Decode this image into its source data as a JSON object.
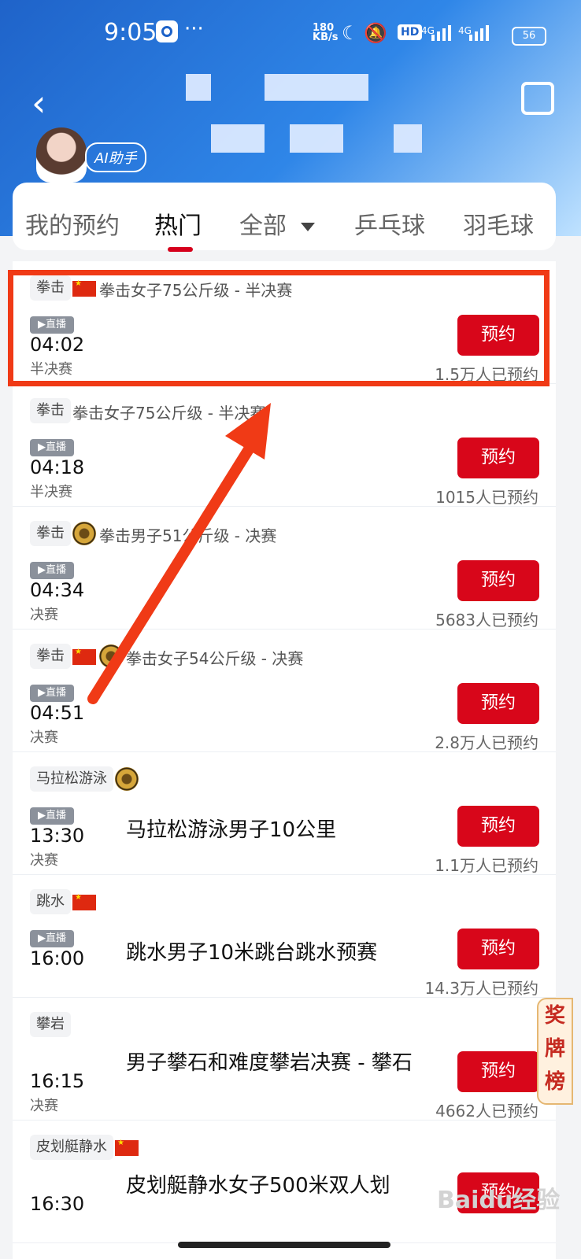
{
  "status_bar": {
    "time": "9:05",
    "more": "···",
    "speed_top": "180",
    "speed_bottom": "KB/s",
    "hd": "HD",
    "network_1": "4G",
    "network_2": "4G",
    "battery": "56",
    "icons": [
      "app-icon",
      "moon-icon",
      "mute-icon"
    ]
  },
  "header": {
    "back_icon": "‹",
    "ai_label": "AI助手",
    "colors": {
      "primary": "#1f63c9",
      "accent": "#d8061a"
    }
  },
  "tabs": [
    {
      "label": "我的预约"
    },
    {
      "label": "热门"
    },
    {
      "label": "全部"
    },
    {
      "label": "乒乓球"
    },
    {
      "label": "羽毛球"
    }
  ],
  "events": [
    {
      "sport": "拳击",
      "title": "拳击女子75公斤级 - 半决赛",
      "live": "▶直播",
      "time": "04:02",
      "stage": "半决赛",
      "button": "预约",
      "count": "1.5万人已预约"
    },
    {
      "sport": "拳击",
      "title": "拳击女子75公斤级 - 半决赛",
      "live": "▶直播",
      "time": "04:18",
      "stage": "半决赛",
      "button": "预约",
      "count": "1015人已预约"
    },
    {
      "sport": "拳击",
      "title": "拳击男子51公斤级 - 决赛",
      "live": "▶直播",
      "time": "04:34",
      "stage": "决赛",
      "button": "预约",
      "count": "5683人已预约"
    },
    {
      "sport": "拳击",
      "title": "拳击女子54公斤级 - 决赛",
      "live": "▶直播",
      "time": "04:51",
      "stage": "决赛",
      "button": "预约",
      "count": "2.8万人已预约"
    },
    {
      "sport": "马拉松游泳",
      "title": "马拉松游泳男子10公里",
      "live": "▶直播",
      "time": "13:30",
      "stage": "决赛",
      "button": "预约",
      "count": "1.1万人已预约"
    },
    {
      "sport": "跳水",
      "title": "跳水男子10米跳台跳水预赛",
      "live": "▶直播",
      "time": "16:00",
      "stage": "",
      "button": "预约",
      "count": "14.3万人已预约"
    },
    {
      "sport": "攀岩",
      "title": "男子攀石和难度攀岩决赛 - 攀石",
      "live": "",
      "time": "16:15",
      "stage": "决赛",
      "button": "预约",
      "count": "4662人已预约"
    },
    {
      "sport": "皮划艇静水",
      "title": "皮划艇静水女子500米双人划",
      "live": "",
      "time": "16:30",
      "stage": "",
      "button": "预约",
      "count": ""
    }
  ],
  "side_badge": "奖牌榜",
  "watermark": "Baidu经验"
}
